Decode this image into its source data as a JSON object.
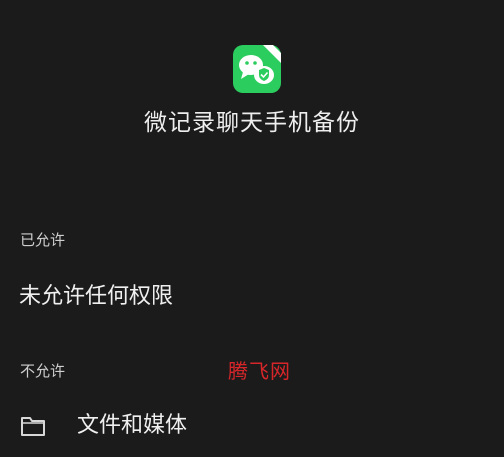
{
  "app": {
    "title": "微记录聊天手机备份",
    "icon": "wechat-backup-app-icon",
    "icon_color": "#2ccd5f"
  },
  "sections": {
    "allowed": {
      "header": "已允许",
      "empty_text": "未允许任何权限"
    },
    "denied": {
      "header": "不允许",
      "items": [
        {
          "label": "文件和媒体",
          "icon": "folder-icon"
        }
      ]
    }
  },
  "watermark": {
    "text": "腾飞网",
    "color": "#d7262a"
  },
  "colors": {
    "background": "#1b1b1b",
    "text": "#ececec"
  }
}
